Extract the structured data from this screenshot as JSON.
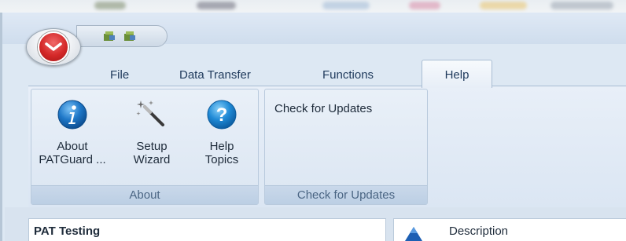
{
  "tabs": [
    {
      "label": "File"
    },
    {
      "label": "Data Transfer"
    },
    {
      "label": "Functions"
    },
    {
      "label": "Help",
      "active": true
    }
  ],
  "ribbon": {
    "about_group": {
      "label": "About",
      "buttons": [
        {
          "label_line1": "About",
          "label_line2": "PATGuard ...",
          "icon": "info-icon"
        },
        {
          "label_line1": "Setup",
          "label_line2": "Wizard",
          "icon": "magic-wand-icon"
        },
        {
          "label_line1": "Help",
          "label_line2": "Topics",
          "icon": "help-icon"
        }
      ]
    },
    "updates_group": {
      "label": "Check for Updates",
      "button_label": "Check for Updates"
    }
  },
  "panels": {
    "left_title": "PAT Testing",
    "right_title": "Description"
  },
  "colors": {
    "accent_red": "#d42828",
    "info_blue": "#1f78c8",
    "help_blue": "#1f8ad6",
    "ribbon_bg": "#dbe6f3",
    "text": "#1e2b3a"
  }
}
